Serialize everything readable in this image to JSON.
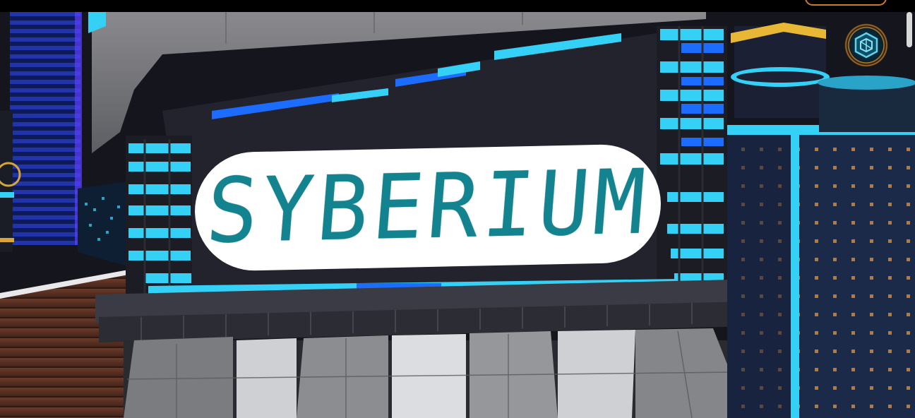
{
  "game": {
    "sign_text": "SYBERIUM"
  },
  "icons": {
    "menu_badge": "cube-emblem-icon"
  },
  "colors": {
    "neon_cyan": "#35d0f5",
    "neon_blue": "#1c6cff",
    "logo_teal": "#13848f",
    "accent_gold": "#d8a53a"
  }
}
